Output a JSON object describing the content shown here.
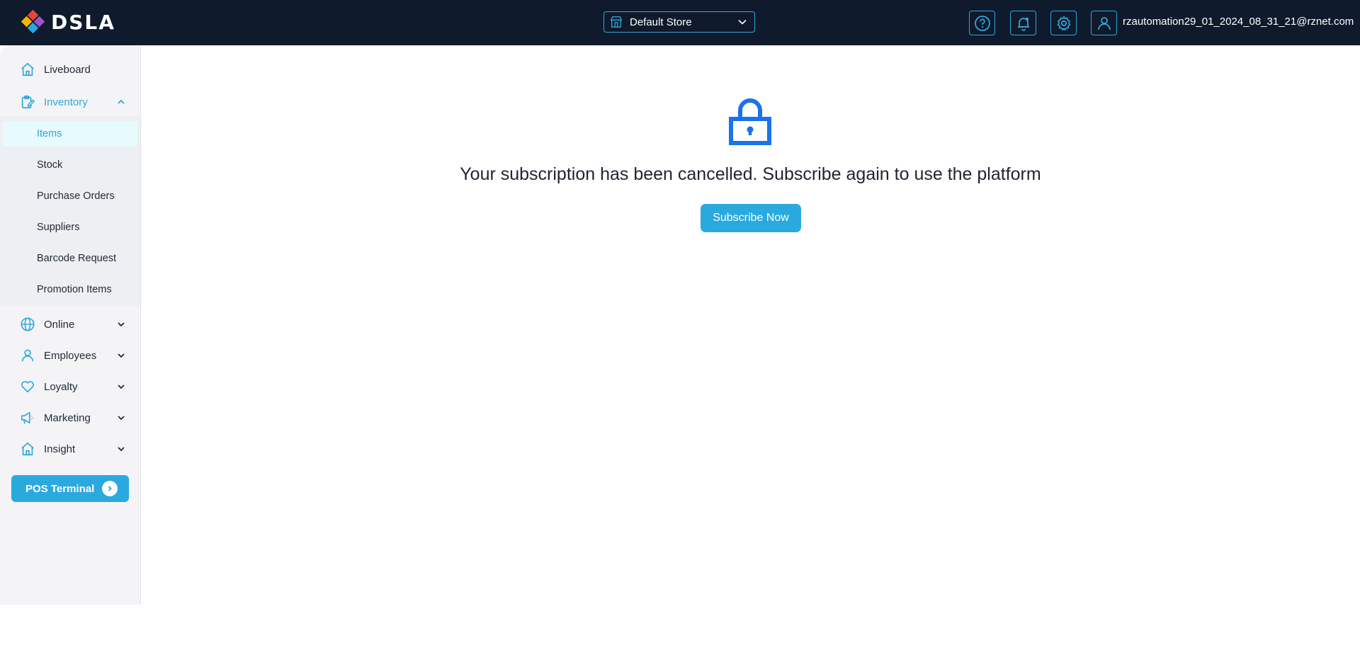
{
  "app": {
    "logo_text": "DSLA"
  },
  "header": {
    "store_selector": {
      "value": "Default Store"
    },
    "icons": [
      "help-icon",
      "bell-icon",
      "gear-icon",
      "user-icon"
    ],
    "user_email": "rzautomation29_01_2024_08_31_21@rznet.com"
  },
  "sidebar": {
    "items": [
      {
        "label": "Liveboard",
        "icon": "home-icon"
      },
      {
        "label": "Inventory",
        "icon": "clipboard-icon",
        "expanded": true
      },
      {
        "label": "Online",
        "icon": "globe-icon"
      },
      {
        "label": "Employees",
        "icon": "user-icon"
      },
      {
        "label": "Loyalty",
        "icon": "heart-icon"
      },
      {
        "label": "Marketing",
        "icon": "megaphone-icon"
      },
      {
        "label": "Insight",
        "icon": "home-icon"
      }
    ],
    "inventory_subitems": [
      {
        "label": "Items",
        "selected": true
      },
      {
        "label": "Stock"
      },
      {
        "label": "Purchase Orders"
      },
      {
        "label": "Suppliers"
      },
      {
        "label": "Barcode Request"
      },
      {
        "label": "Promotion Items"
      }
    ],
    "pos_terminal_label": "POS Terminal"
  },
  "main": {
    "message": "Your subscription has been cancelled. Subscribe again to use the platform",
    "subscribe_label": "Subscribe Now"
  },
  "colors": {
    "topbar": "#0f1a2c",
    "accent": "#2aa9df",
    "lock": "#1a73e8",
    "sidebar_bg": "#f4f4f6",
    "selected_bg": "#e7fafd"
  }
}
